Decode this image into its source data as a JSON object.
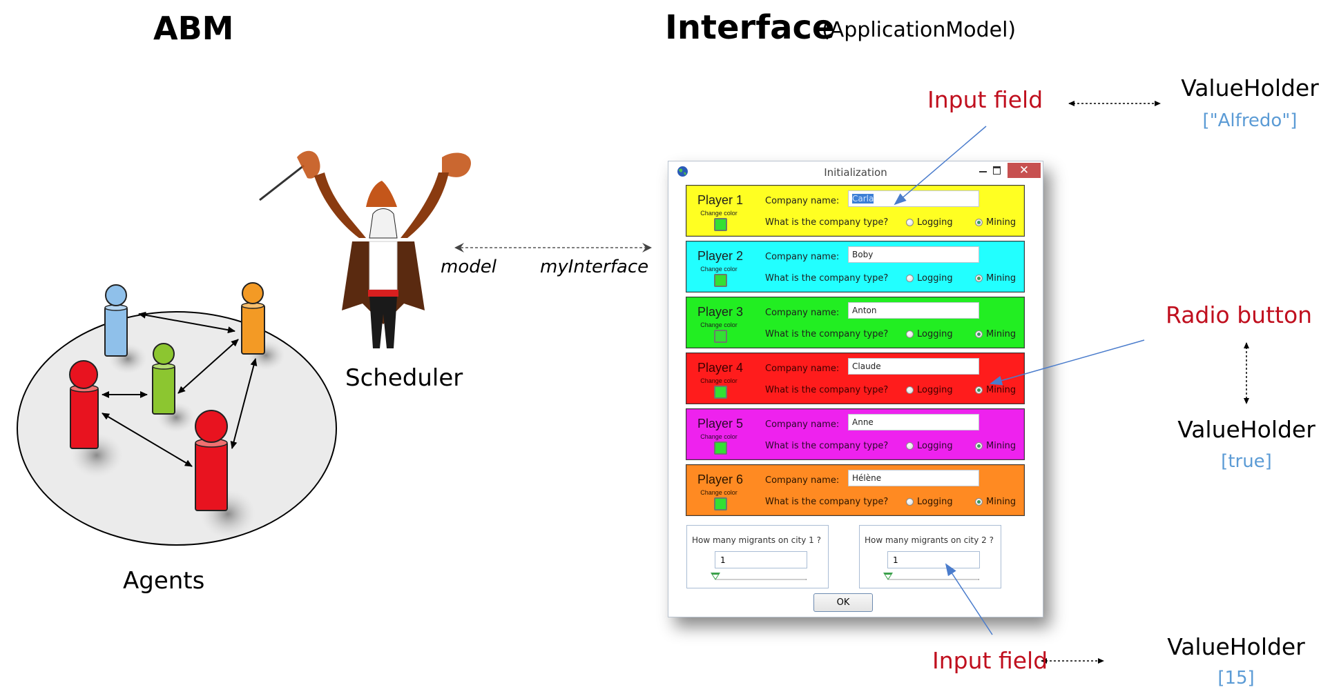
{
  "headings": {
    "abm": "ABM",
    "interface": "Interface",
    "interface_sub": "(ApplicationModel)"
  },
  "left": {
    "agents_label": "Agents",
    "scheduler_label": "Scheduler",
    "agents": [
      {
        "color": "#8fc0ea",
        "name": "blue-agent"
      },
      {
        "color": "#f39a25",
        "name": "orange-agent"
      },
      {
        "color": "#8cc630",
        "name": "green-agent"
      },
      {
        "color": "#e8131f",
        "name": "red-agent-left"
      },
      {
        "color": "#e8131f",
        "name": "red-agent-right"
      }
    ]
  },
  "link": {
    "model_label": "model",
    "interface_label": "myInterface"
  },
  "dialog": {
    "title": "Initialization",
    "close_glyph": "✕",
    "ok_label": "OK",
    "change_color_label": "Change color",
    "company_name_label": "Company name:",
    "question": "What is the company type?",
    "option_logging": "Logging",
    "option_mining": "Mining",
    "players": [
      {
        "label": "Player 1",
        "color": "#ffff22",
        "text_color": "#1e1e1e",
        "company": "Carla",
        "type": "Mining",
        "selected_text": true
      },
      {
        "label": "Player 2",
        "color": "#22ffff",
        "text_color": "#1e1e1e",
        "company": "Boby",
        "type": "Mining"
      },
      {
        "label": "Player 3",
        "color": "#22ee22",
        "text_color": "#1e1e1e",
        "company": "Anton",
        "type": "Mining"
      },
      {
        "label": "Player 4",
        "color": "#ff1c1c",
        "text_color": "#3a0000",
        "company": "Claude",
        "type": "Mining"
      },
      {
        "label": "Player 5",
        "color": "#ee22ee",
        "text_color": "#2a0a2a",
        "company": "Anne",
        "type": "Mining"
      },
      {
        "label": "Player 6",
        "color": "#ff8a22",
        "text_color": "#2a1400",
        "company": "Hélène",
        "type": "Mining"
      }
    ],
    "cities": [
      {
        "label": "How many migrants on city  1 ?",
        "value": "1",
        "slider_fraction": 0
      },
      {
        "label": "How many migrants on city  2 ?",
        "value": "1",
        "slider_fraction": 0
      }
    ]
  },
  "annotations": {
    "input_field_top": "Input field",
    "valueholder_top": "ValueHolder",
    "valueholder_top_value": "[\"Alfredo\"]",
    "radio_button": "Radio button",
    "valueholder_mid": "ValueHolder",
    "valueholder_mid_value": "[true]",
    "input_field_bottom": "Input field",
    "valueholder_bottom": "ValueHolder",
    "valueholder_bottom_value": "[15]"
  }
}
